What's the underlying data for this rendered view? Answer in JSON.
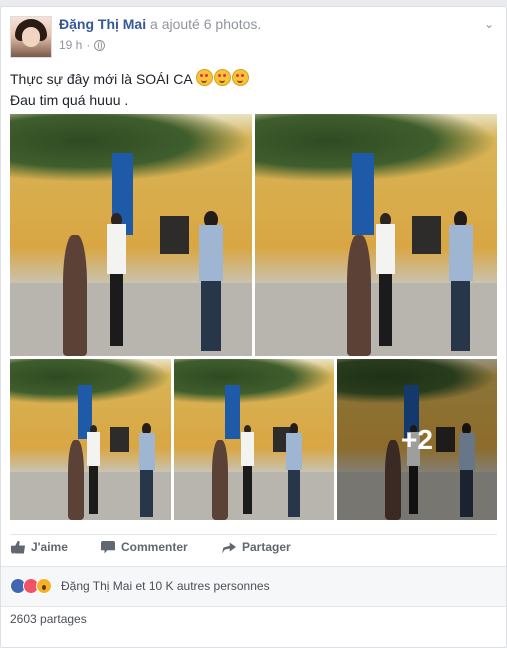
{
  "post": {
    "author_name": "Đặng Thị Mai",
    "action_text": "a ajouté 6 photos.",
    "timestamp": "19 h",
    "menu_icon": "chevron-down-icon",
    "privacy_icon": "globe-icon",
    "text_line1": "Thực sự đây mới là SOÁI CA",
    "text_line2": "Đau tim quá huuu ."
  },
  "photos": {
    "count_shown": 5,
    "more_overlay": "+2"
  },
  "actions": {
    "like_label": "J'aime",
    "comment_label": "Commenter",
    "share_label": "Partager"
  },
  "reactions": {
    "icons": [
      "like-icon",
      "love-icon",
      "wow-icon"
    ],
    "summary": "Đặng Thị Mai et 10 K autres personnes"
  },
  "shares": {
    "label": "2603 partages"
  },
  "colors": {
    "link": "#365899",
    "muted": "#90949c",
    "background": "#e9ebee",
    "like_blue": "#4267b2",
    "love_red": "#f25268",
    "wow_yellow": "#f7b125"
  }
}
